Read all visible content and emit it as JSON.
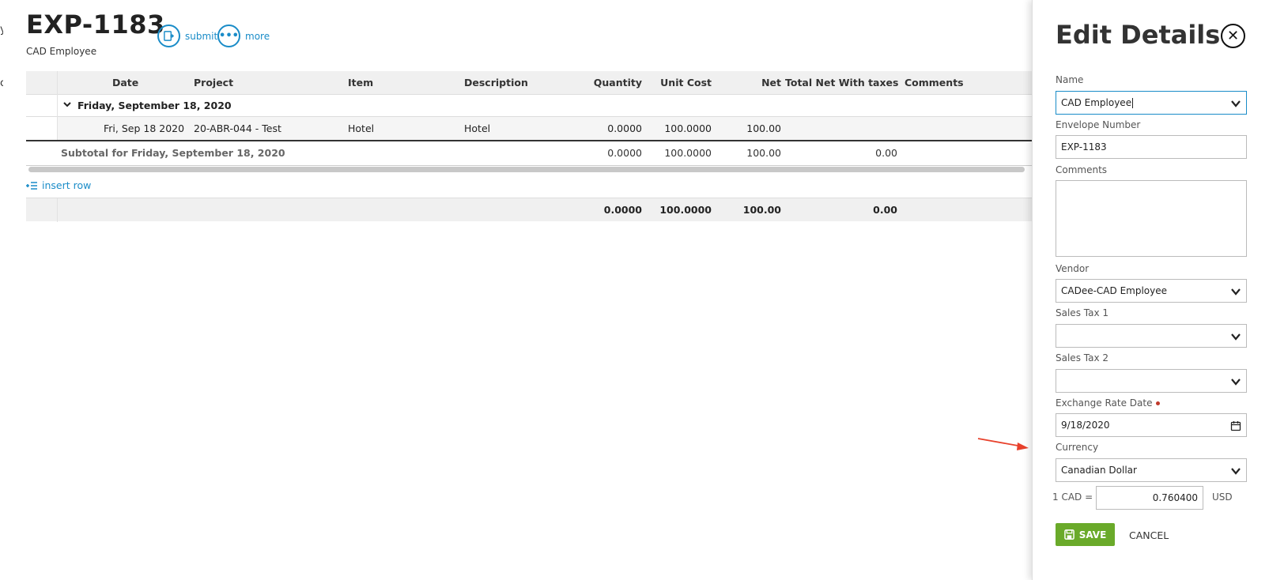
{
  "header": {
    "title": "EXP-1183",
    "subtitle": "CAD Employee",
    "submit_label": "submit",
    "more_label": "more"
  },
  "table": {
    "columns": {
      "date": "Date",
      "project": "Project",
      "item": "Item",
      "description": "Description",
      "quantity": "Quantity",
      "unit_cost": "Unit Cost",
      "net": "Net",
      "total_net_with_taxes": "Total Net With taxes",
      "comments": "Comments"
    },
    "group_label": "Friday, September 18, 2020",
    "row": {
      "date": "Fri, Sep 18 2020",
      "project": "20-ABR-044 - Test",
      "item": "Hotel",
      "description": "Hotel",
      "quantity": "0.0000",
      "unit_cost": "100.0000",
      "net": "100.00"
    },
    "subtotal": {
      "label": "Subtotal for Friday, September 18, 2020",
      "quantity": "0.0000",
      "unit_cost": "100.0000",
      "net": "100.00",
      "total_net_with_taxes": "0.00"
    },
    "insert_row_label": "insert row",
    "totals": {
      "quantity": "0.0000",
      "unit_cost": "100.0000",
      "net": "100.00",
      "total_net_with_taxes": "0.00"
    }
  },
  "panel": {
    "title": "Edit Details",
    "name_label": "Name",
    "name_value": "CAD Employee",
    "envelope_label": "Envelope Number",
    "envelope_value": "EXP-1183",
    "comments_label": "Comments",
    "vendor_label": "Vendor",
    "vendor_value": "CADee-CAD Employee",
    "sales_tax1_label": "Sales Tax 1",
    "sales_tax2_label": "Sales Tax 2",
    "exchange_date_label": "Exchange Rate Date",
    "exchange_date_value": "9/18/2020",
    "currency_label": "Currency",
    "currency_value": "Canadian Dollar",
    "rate_prefix": "1 CAD =",
    "rate_value": "0.760400",
    "rate_unit": "USD",
    "save_label": "SAVE",
    "cancel_label": "CANCEL"
  },
  "colors": {
    "accent": "#1a8cc8",
    "save_green": "#6aaa2a",
    "annotation_arrow": "#e8412c",
    "required_dot": "#c0392b"
  }
}
